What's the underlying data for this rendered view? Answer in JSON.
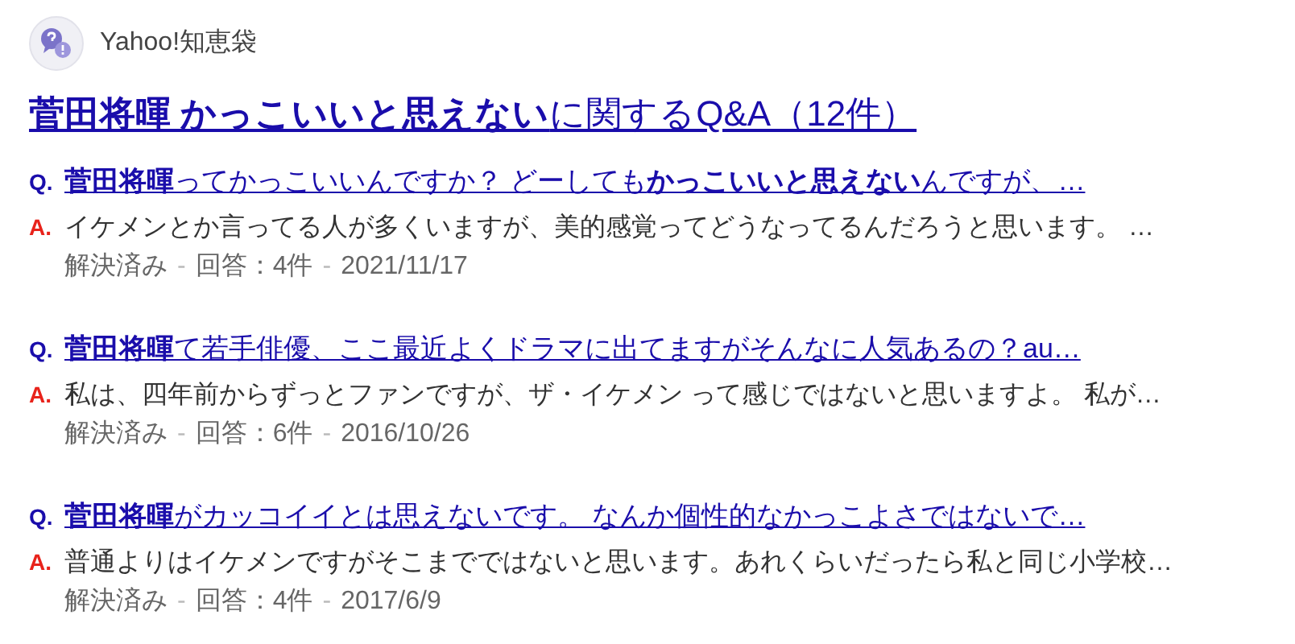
{
  "source": {
    "name": "Yahoo!知恵袋"
  },
  "title": "**菅田将暉 かっこいいと思えない**に関するQ&A（12件）",
  "results": [
    {
      "q_mark": "Q.",
      "question": "**菅田将暉**ってかっこいいんですか？ どーしても**かっこいいと思えない**んですが、…",
      "a_mark": "A.",
      "answer": "イケメンとか言ってる人が多くいますが、美的感覚ってどうなってるんだろうと思います。 …",
      "status": "解決済み",
      "separator": "-",
      "answers": "回答：4件",
      "date": "2021/11/17"
    },
    {
      "q_mark": "Q.",
      "question": "**菅田将暉**て若手俳優、ここ最近よくドラマに出てますがそんなに人気あるの？au…",
      "a_mark": "A.",
      "answer": "私は、四年前からずっとファンですが、ザ・イケメン って感じではないと思いますよ。 私が…",
      "status": "解決済み",
      "separator": "-",
      "answers": "回答：6件",
      "date": "2016/10/26"
    },
    {
      "q_mark": "Q.",
      "question": "**菅田将暉**がカッコイイとは思えないです。 なんか個性的なかっこよさではないで…",
      "a_mark": "A.",
      "answer": "普通よりはイケメンですがそこまでではないと思います。あれくらいだったら私と同じ小学校…",
      "status": "解決済み",
      "separator": "-",
      "answers": "回答：4件",
      "date": "2017/6/9"
    }
  ]
}
